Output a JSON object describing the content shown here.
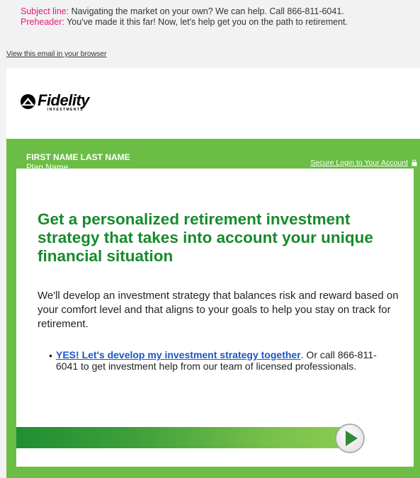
{
  "meta": {
    "subject_label": "Subject line:",
    "subject_text": " Navigating the market on your own? We can help. Call 866-811-6041.",
    "preheader_label": "Preheader:",
    "preheader_text": " You've made it this far! Now, let's help get you on the path to retirement."
  },
  "view_link": "View this email in your browser",
  "logo": {
    "brand": "Fidelity",
    "sub": "INVESTMENTS",
    "icon": "fidelity-pyramid-icon"
  },
  "header": {
    "name": "FIRST NAME LAST NAME",
    "plan": "Plan Name",
    "login_label": "Secure Login to Your Account",
    "lock_icon": "lock-icon"
  },
  "main": {
    "headline": "Get a personalized retirement investment strategy that takes into account your unique financial situation",
    "body": "We'll develop an investment strategy that balances risk and reward based on your comfort level and that aligns to your goals to help you stay on track for retirement.",
    "bullet_cta": "YES! Let's develop my investment strategy together",
    "bullet_rest": ". Or call 866-811-6041 to get investment help from our team of licensed professionals."
  },
  "colors": {
    "brand_green": "#6bbd45",
    "headline_green": "#178a2b",
    "link_blue": "#1a56c4",
    "label_pink": "#e0197d"
  },
  "arrow_icon": "arrow-right-circle-icon"
}
